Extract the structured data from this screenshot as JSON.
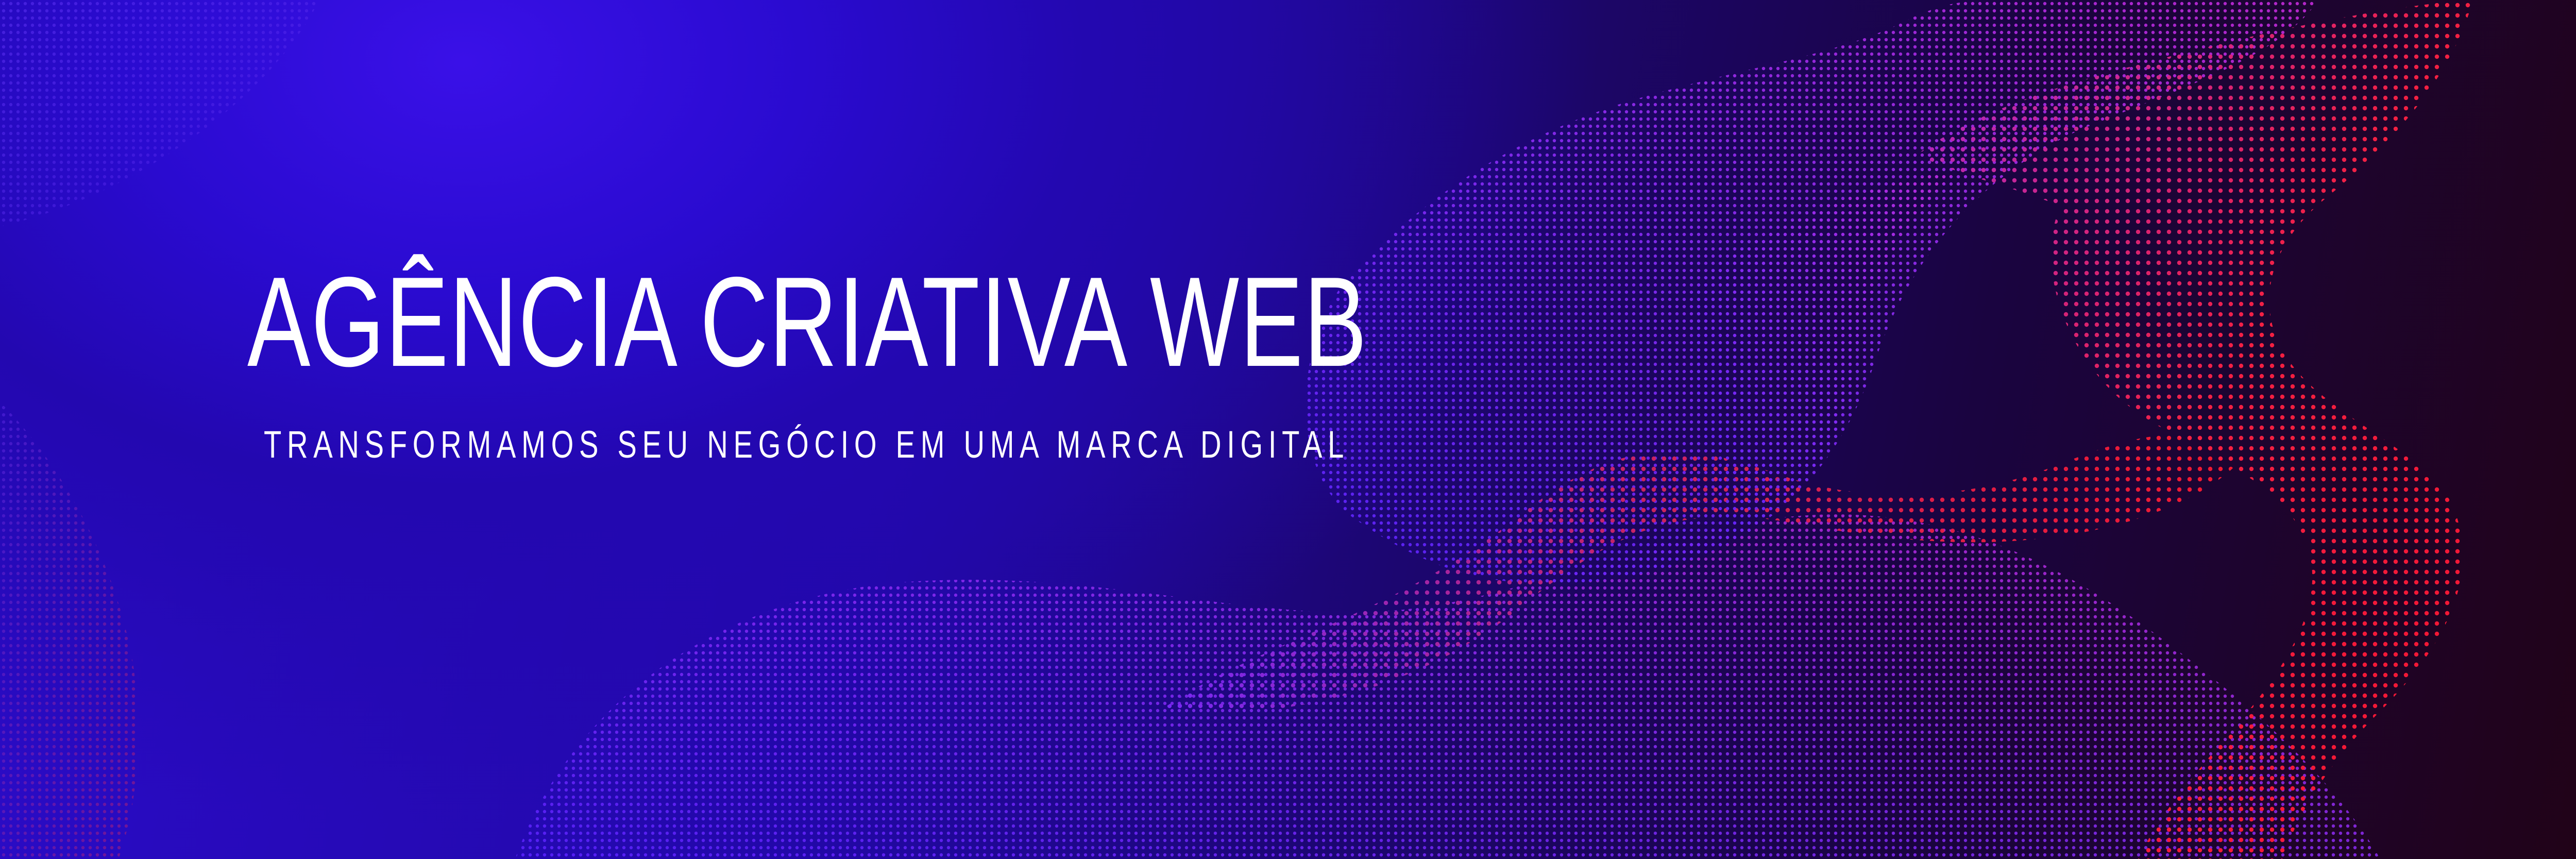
{
  "banner": {
    "headline": "AGÊNCIA CRIATIVA WEB",
    "tagline": "TRANSFORMAMOS SEU NEGÓCIO EM UMA MARCA DIGITAL"
  },
  "colors": {
    "background_primary": "#2a0bd0",
    "background_dark": "#210318",
    "wave_blue": "#6a2cff",
    "wave_violet": "#9b2cf0",
    "wave_red": "#ff1a3c",
    "text": "#ffffff"
  },
  "decoration": {
    "pattern": "dotted-particle-waves"
  }
}
